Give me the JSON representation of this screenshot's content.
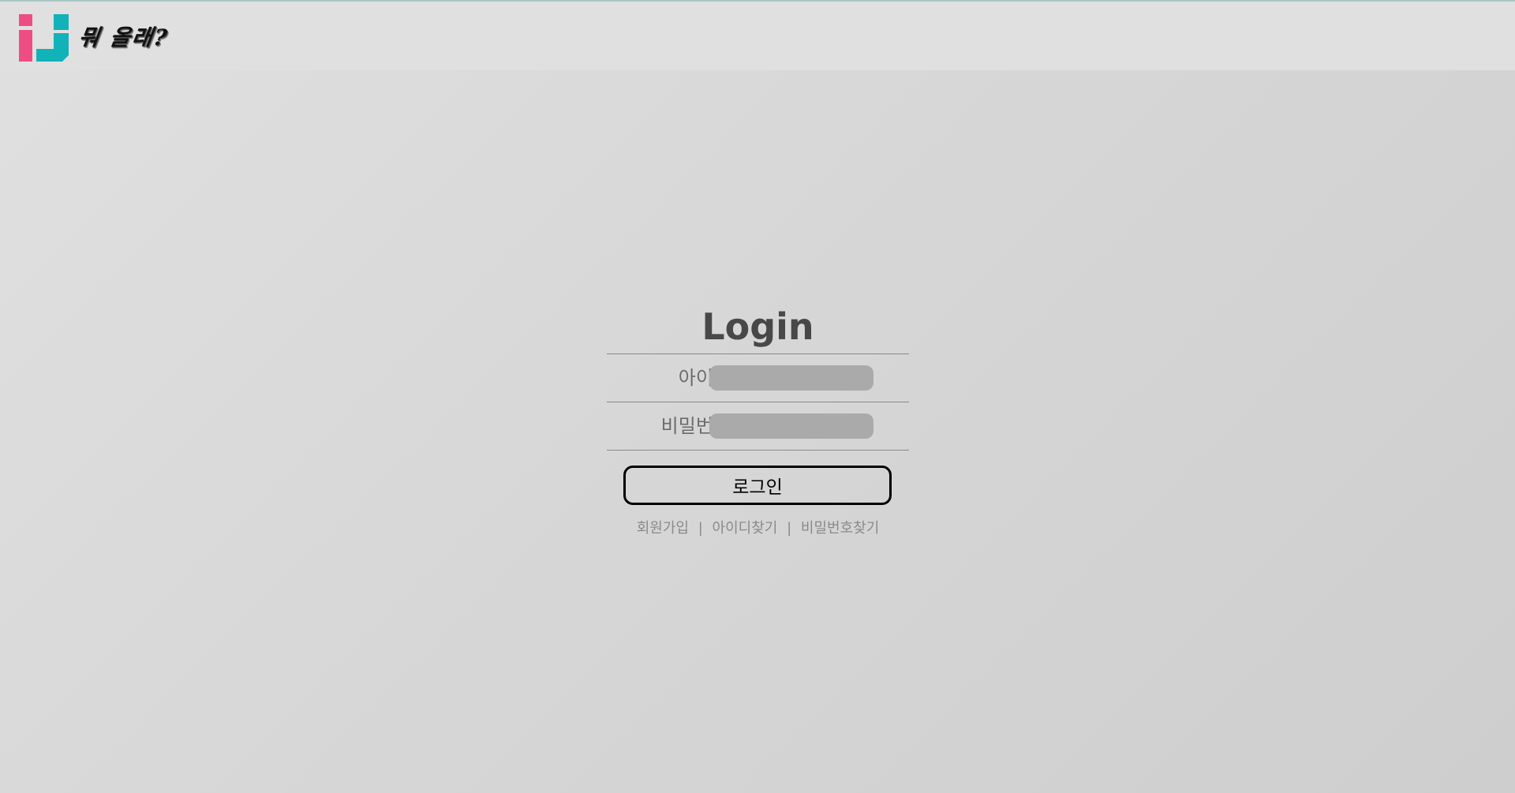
{
  "header": {
    "brand_text": "뭐 올래?",
    "logo": {
      "icon": "ij-logo-icon",
      "colors": {
        "pink": "#ee4d84",
        "teal": "#11b2b8"
      }
    }
  },
  "login": {
    "title": "Login",
    "fields": [
      {
        "label": "아이디",
        "value": "",
        "placeholder": ""
      },
      {
        "label": "비밀번호",
        "value": "",
        "placeholder": ""
      }
    ],
    "submit_label": "로그인",
    "links": {
      "signup": "회원가입",
      "find_id": "아이디찾기",
      "find_password": "비밀번호찾기",
      "separator": "|"
    }
  },
  "colors": {
    "input_bg": "#aaaaaa",
    "label_text": "#6b6b6b",
    "title_text": "#484848",
    "link_text": "#8a8a8a"
  }
}
